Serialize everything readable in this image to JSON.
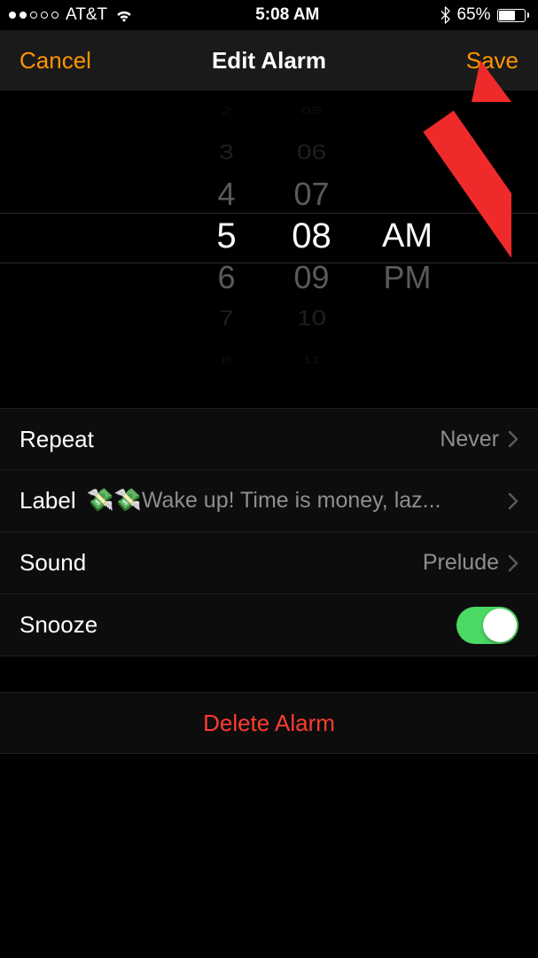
{
  "status_bar": {
    "signal_filled": 2,
    "signal_total": 5,
    "carrier": "AT&T",
    "time": "5:08 AM",
    "battery_percent_text": "65%",
    "battery_fill_percent": 65
  },
  "nav": {
    "cancel": "Cancel",
    "title": "Edit Alarm",
    "save": "Save"
  },
  "picker": {
    "hours": [
      "2",
      "3",
      "4",
      "5",
      "6",
      "7",
      "8"
    ],
    "minutes": [
      "05",
      "06",
      "07",
      "08",
      "09",
      "10",
      "11"
    ],
    "ampm": [
      "AM",
      "PM"
    ],
    "selected_hour": "5",
    "selected_minute": "08",
    "selected_ampm": "AM"
  },
  "settings": {
    "repeat": {
      "label": "Repeat",
      "value": "Never"
    },
    "label": {
      "label": "Label",
      "value": "💸💸Wake up! Time is money, laz..."
    },
    "sound": {
      "label": "Sound",
      "value": "Prelude"
    },
    "snooze": {
      "label": "Snooze",
      "enabled": true
    }
  },
  "delete_label": "Delete Alarm",
  "colors": {
    "accent": "#ff9500",
    "destructive": "#ff3b30",
    "switch_on": "#4cd964",
    "secondary_text": "#8e8e93"
  }
}
